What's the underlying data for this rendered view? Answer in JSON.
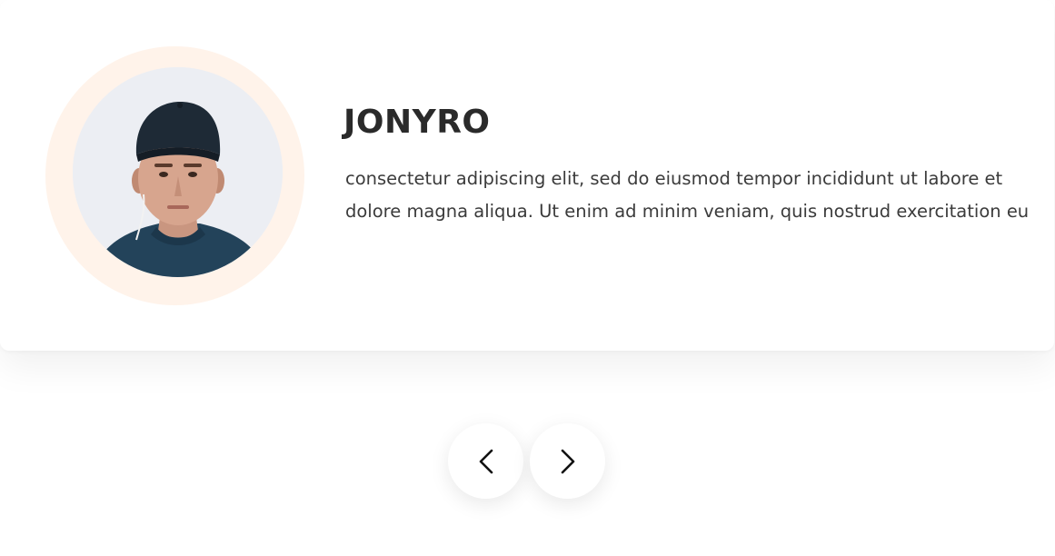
{
  "testimonial": {
    "name": "JONYRO",
    "quote": "consectetur adipiscing elit, sed do eiusmod tempor incididunt ut labore et dolore magna aliqua. Ut enim ad minim veniam, quis nostrud exercitation eu",
    "avatar_alt": "Portrait of a young man wearing a dark cap and navy t-shirt"
  },
  "navigation": {
    "prev_icon": "chevron-left-icon",
    "next_icon": "chevron-right-icon"
  },
  "colors": {
    "avatar_ring": "#fff3ea",
    "name_text": "#2a2a2a",
    "body_text": "#3b3b3b",
    "card_background": "#ffffff"
  }
}
